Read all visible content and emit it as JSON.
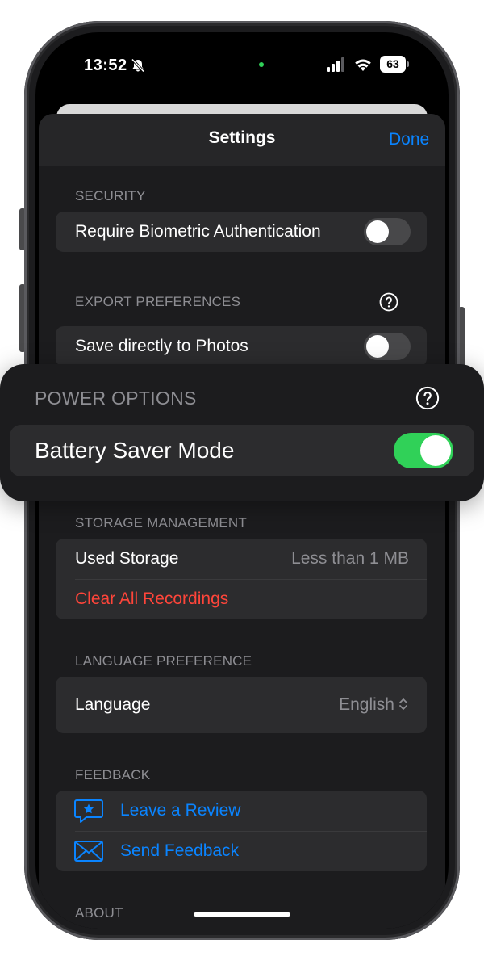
{
  "status_bar": {
    "time": "13:52",
    "battery_level": "63"
  },
  "nav": {
    "title": "Settings",
    "done_label": "Done"
  },
  "sections": {
    "security": {
      "header": "SECURITY",
      "rows": [
        {
          "label": "Require Biometric Authentication",
          "toggle_on": false
        }
      ]
    },
    "export": {
      "header": "EXPORT PREFERENCES",
      "rows": [
        {
          "label": "Save directly to Photos",
          "toggle_on": false
        }
      ]
    },
    "power": {
      "header": "POWER OPTIONS",
      "rows": [
        {
          "label": "Battery Saver Mode",
          "toggle_on": true
        }
      ]
    },
    "storage": {
      "header": "STORAGE MANAGEMENT",
      "used_label": "Used Storage",
      "used_value": "Less than 1 MB",
      "clear_label": "Clear All Recordings"
    },
    "language": {
      "header": "LANGUAGE PREFERENCE",
      "label": "Language",
      "value": "English"
    },
    "feedback": {
      "header": "FEEDBACK",
      "review_label": "Leave a Review",
      "send_label": "Send Feedback"
    },
    "about": {
      "header": "ABOUT"
    }
  },
  "colors": {
    "accent": "#0a84ff",
    "destructive": "#ff453a",
    "toggle_on": "#30d158",
    "toggle_off": "#48484a"
  }
}
